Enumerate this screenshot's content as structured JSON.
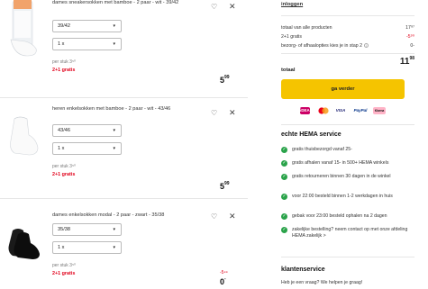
{
  "items": [
    {
      "title": "dames sneakersokken met bamboe - 2 paar - wit - 39/42",
      "size": "39/42",
      "qty": "1 x",
      "per_stuk": "per stuk 3⁵⁰",
      "promo": "2+1 gratis",
      "price_main": "5",
      "price_sup": "99"
    },
    {
      "title": "heren enkelsokken met bamboe - 2 paar - wit - 43/46",
      "size": "43/46",
      "qty": "1 x",
      "per_stuk": "per stuk 3⁵⁰",
      "promo": "2+1 gratis",
      "price_main": "5",
      "price_sup": "99"
    },
    {
      "title": "dames enkelsokken modal - 2 paar - zwart - 35/38",
      "size": "35/38",
      "qty": "1 x",
      "per_stuk": "per stuk 3⁵⁰",
      "promo": "2+1 gratis",
      "old_price": "-5⁹⁹",
      "price_main": "0",
      "price_sup": "-"
    }
  ],
  "icons": {
    "heart": "heart-icon",
    "close": "close-icon",
    "chevron": "chevron-down-icon",
    "check": "check-icon",
    "info": "info-icon"
  },
  "summary": {
    "login": "inloggen",
    "rows": [
      {
        "label": "totaal van alle producten",
        "value": "17⁹⁷"
      },
      {
        "label": "2+1 gratis",
        "value": "-5⁹⁹"
      },
      {
        "label": "bezorg- of afhaalopties kies je in stap 2",
        "value": "0-"
      }
    ],
    "total_label": "totaal",
    "total_main": "11",
    "total_sup": "98",
    "cta": "ga verder"
  },
  "payment": [
    "iDEAL",
    "Mastercard",
    "VISA",
    "PayPal",
    "Klarna"
  ],
  "service": {
    "title": "echte HEMA service",
    "items": [
      "gratis thuisbezorgd vanaf 25-",
      "gratis afhalen vanaf 15- in 500+ HEMA winkels",
      "gratis retourneren binnen 30 dagen in de winkel",
      "voor 22:00 besteld binnen 1-2 werkdagen in huis",
      "gebak voor 23:00 besteld ophalen na 2 dagen",
      "zakelijke bestelling? neem contact op met onze afdeling HEMA zakelijk >"
    ]
  },
  "klantenservice": {
    "title": "klantenservice",
    "text": "Heb je een vraag? We helpen je graag!"
  },
  "colors": {
    "accent_yellow": "#f5c400",
    "promo_red": "#e1001a",
    "check_green": "#2aa34a"
  }
}
